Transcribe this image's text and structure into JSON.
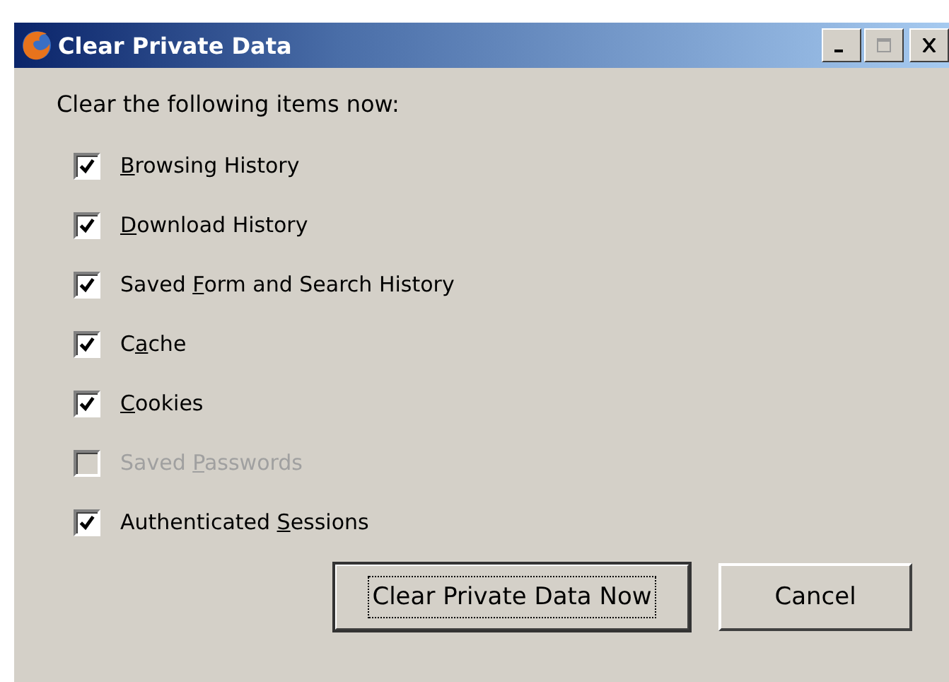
{
  "window": {
    "title": "Clear Private Data"
  },
  "heading": "Clear the following items now:",
  "items": [
    {
      "label": {
        "key": "B",
        "after": "rowsing History"
      },
      "checked": true,
      "disabled": false
    },
    {
      "label": {
        "key": "D",
        "after": "ownload History"
      },
      "checked": true,
      "disabled": false
    },
    {
      "label": {
        "before": "Saved ",
        "key": "F",
        "after": "orm and Search History"
      },
      "checked": true,
      "disabled": false
    },
    {
      "label": {
        "before": "C",
        "key": "a",
        "after": "che"
      },
      "checked": true,
      "disabled": false
    },
    {
      "label": {
        "key": "C",
        "after": "ookies"
      },
      "checked": true,
      "disabled": false
    },
    {
      "label": {
        "before": "Saved ",
        "key": "P",
        "after": "asswords"
      },
      "checked": false,
      "disabled": true
    },
    {
      "label": {
        "before": "Authenticated ",
        "key": "S",
        "after": "essions"
      },
      "checked": true,
      "disabled": false
    }
  ],
  "buttons": [
    {
      "label": "Clear Private Data Now",
      "default": true
    },
    {
      "label": "Cancel",
      "default": false
    }
  ]
}
